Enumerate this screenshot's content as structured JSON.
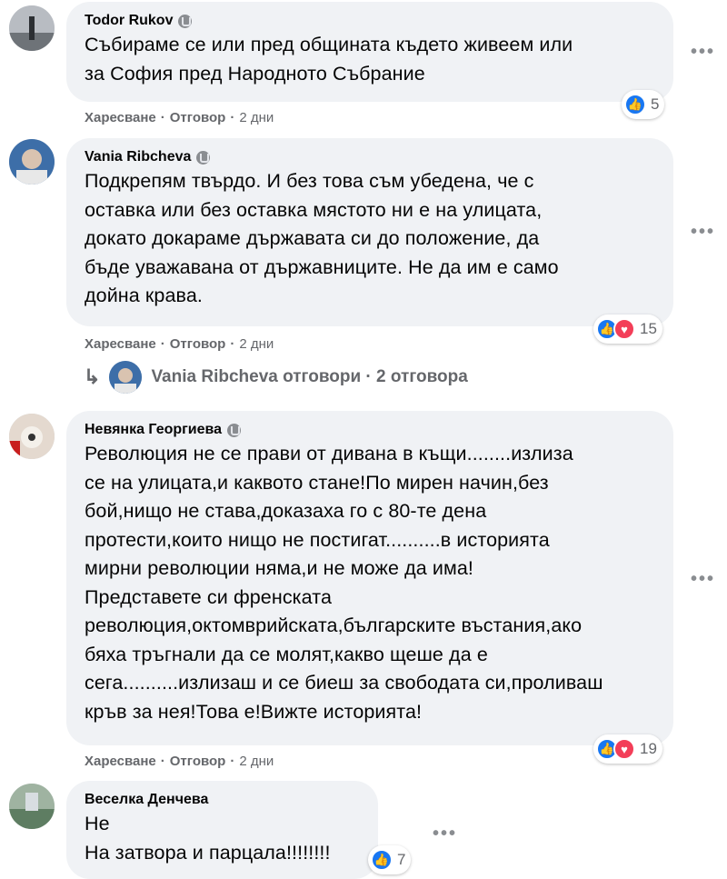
{
  "actions": {
    "like": "Харесване",
    "reply": "Отговор",
    "separator": "·"
  },
  "comments": [
    {
      "author": "Todor Rukov",
      "text": "Събираме се или пред общината където живеем или\nза София пред Народното Събрание",
      "time": "2 дни",
      "reactions": "5"
    },
    {
      "author": "Vania Ribcheva",
      "text": "Подкрепям твърдо. И без това съм убедена, че с\nоставка или без оставка мястото ни е на улицата,\nдокато докараме държавата си до положение, да\nбъде уважавана от държавниците. Не да им е само\nдойна крава.",
      "time": "2 дни",
      "reactions": "15",
      "replies_link": "Vania Ribcheva отговори · 2 отговора"
    },
    {
      "author": "Невянка Георгиева",
      "text": "Революция не се прави от дивана в къщи........излиза\nсе на улицата,и каквото стане!По мирен начин,без\nбой,нищо не става,доказаха го с 80-те дена\nпротести,които нищо не постигат..........в историята\nмирни революции няма,и не може да има!\nПредставете си френската\nреволюция,октомврийската,българските въстания,ако\nбяха тръгнали да се молят,какво щеше да е\nсега..........излизаш и се биеш за свободата си,проливаш\nкръв за нея!Това е!Вижте историята!",
      "time": "2 дни",
      "reactions": "19"
    },
    {
      "author": "Веселка Денчева",
      "text": "Не\nНа затвора и парцала!!!!!!!!",
      "reactions": "7"
    }
  ],
  "icons": {
    "more": "more-options-icon",
    "like": "like-reaction-icon",
    "love": "love-reaction-icon",
    "reply_arrow": "reply-arrow-icon",
    "badge": "top-fan-badge-icon"
  },
  "colors": {
    "bubble": "#f0f2f5",
    "like": "#1877f2",
    "love": "#f33e58",
    "meta": "#65676b"
  }
}
